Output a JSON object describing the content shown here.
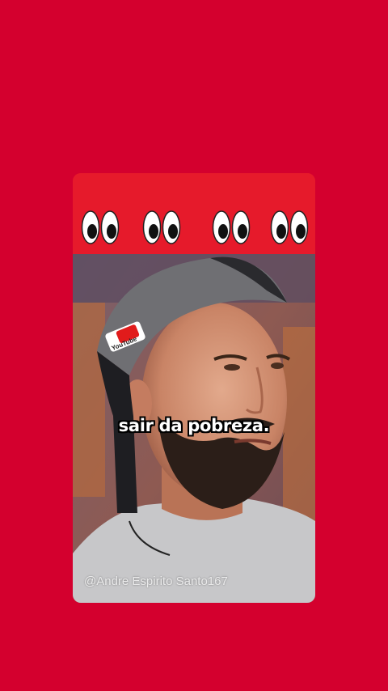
{
  "background_color": "#d4002e",
  "emoji_bar": {
    "color": "#e61a2b",
    "emojis": [
      "eyes-emoji",
      "eyes-emoji",
      "eyes-emoji",
      "eyes-emoji"
    ]
  },
  "video": {
    "caption": "sair da pobreza.",
    "watermark": "@Andre Espirito Santo167",
    "cap_logo_text": "YouTube"
  }
}
